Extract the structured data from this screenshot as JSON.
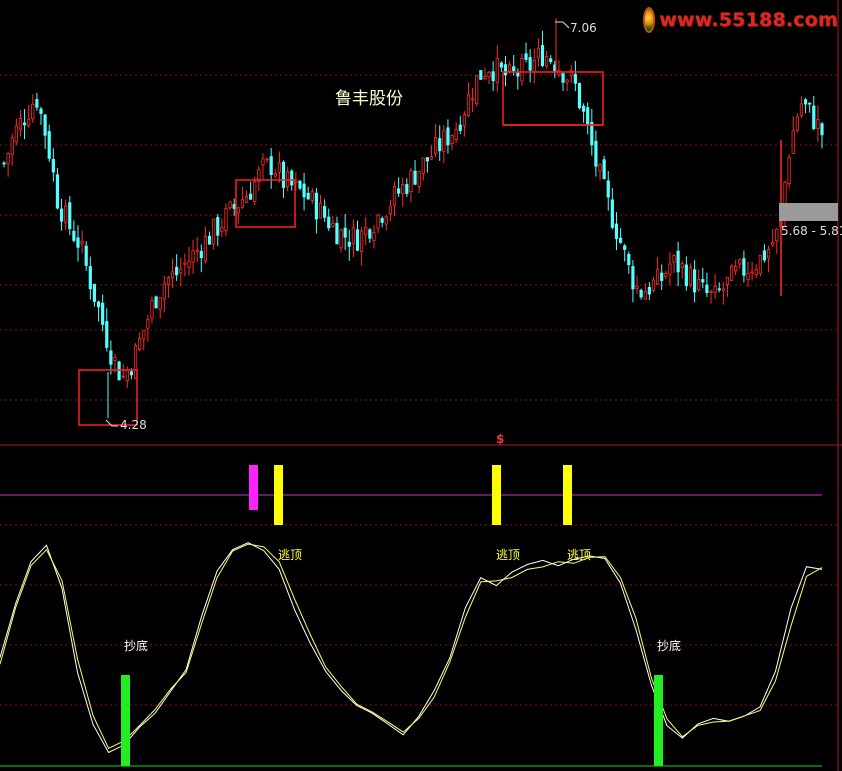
{
  "stock_name": "鲁丰股份",
  "watermark": {
    "site": "www.55188.com",
    "icon": "55188-logo-icon"
  },
  "price_panel": {
    "high_label": "7.06",
    "low_label": "4.28",
    "range_label": "5.68 - 5.81"
  },
  "indicator_panel": {
    "marker": "$",
    "signals": [
      {
        "text": "逃顶",
        "kind": "sell"
      },
      {
        "text": "逃顶",
        "kind": "sell"
      },
      {
        "text": "逃顶",
        "kind": "sell"
      },
      {
        "text": "抄底",
        "kind": "buy"
      },
      {
        "text": "抄底",
        "kind": "buy"
      }
    ]
  },
  "colors": {
    "background": "#000000",
    "up_candle": "#ff2a2a",
    "down_candle": "#54ffff",
    "grid": "#8a1010",
    "box": "#ff2020",
    "white_line": "#ffffff",
    "yellow_line": "#ffff66",
    "buy_bar": "#22ee22",
    "sell_bar": "#ffff00",
    "magenta_bar": "#ff22ff",
    "top_level": "#cc33cc",
    "bottom_level": "#22cc22"
  },
  "chart_data": [
    {
      "type": "candlestick",
      "title": "鲁丰股份",
      "annotations": [
        "7.06",
        "4.28",
        "5.68 - 5.81"
      ],
      "max_price": 7.06,
      "min_price": 4.28,
      "last_range": [
        5.68,
        5.81
      ],
      "close_trajectory": [
        6.05,
        6.3,
        6.45,
        6.6,
        6.25,
        5.75,
        5.55,
        5.4,
        5.1,
        4.8,
        4.5,
        4.3,
        4.45,
        4.7,
        4.95,
        5.1,
        5.15,
        5.25,
        5.35,
        5.45,
        5.55,
        5.65,
        5.75,
        5.85,
        6.0,
        6.05,
        5.9,
        5.85,
        5.8,
        5.7,
        5.6,
        5.5,
        5.45,
        5.45,
        5.55,
        5.65,
        5.75,
        5.85,
        5.95,
        6.05,
        6.15,
        6.25,
        6.35,
        6.55,
        6.75,
        6.85,
        6.8,
        6.75,
        6.8,
        6.85,
        6.95,
        6.9,
        6.8,
        6.7,
        6.4,
        6.05,
        5.75,
        5.5,
        5.2,
        5.0,
        5.05,
        5.1,
        5.25,
        5.2,
        5.1,
        5.0,
        4.95,
        5.05,
        5.15,
        5.2,
        5.25,
        5.35,
        5.5,
        6.2,
        6.55,
        6.45,
        6.3
      ]
    },
    {
      "type": "line",
      "series": [
        {
          "name": "",
          "color": "white",
          "values": [
            40,
            60,
            75,
            82,
            65,
            35,
            15,
            5,
            8,
            14,
            20,
            27,
            36,
            55,
            72,
            80,
            82,
            80,
            72,
            58,
            45,
            35,
            28,
            22,
            20,
            15,
            12,
            18,
            28,
            40,
            58,
            70,
            66,
            72,
            74,
            76,
            74,
            76,
            78,
            76,
            68,
            50,
            30,
            15,
            10,
            16,
            17,
            17,
            18,
            22,
            35,
            58,
            74,
            72
          ]
        },
        {
          "name": "",
          "color": "yellow",
          "values": [
            38,
            58,
            74,
            80,
            68,
            40,
            18,
            7,
            9,
            15,
            21,
            28,
            35,
            52,
            70,
            79,
            82,
            81,
            75,
            62,
            48,
            37,
            29,
            23,
            20,
            16,
            13,
            17,
            26,
            38,
            55,
            68,
            68,
            70,
            72,
            74,
            75,
            75,
            77,
            77,
            70,
            54,
            33,
            17,
            11,
            15,
            16,
            17,
            18,
            21,
            31,
            52,
            70,
            73
          ]
        }
      ],
      "top_level": 92,
      "bottom_level": 0,
      "signals": [
        {
          "label": "",
          "color": "magenta"
        },
        {
          "label": "逃顶",
          "color": "yellow"
        },
        {
          "label": "逃顶",
          "color": "yellow"
        },
        {
          "label": "逃顶",
          "color": "yellow"
        },
        {
          "label": "抄底",
          "color": "green"
        },
        {
          "label": "抄底",
          "color": "green"
        }
      ]
    }
  ]
}
